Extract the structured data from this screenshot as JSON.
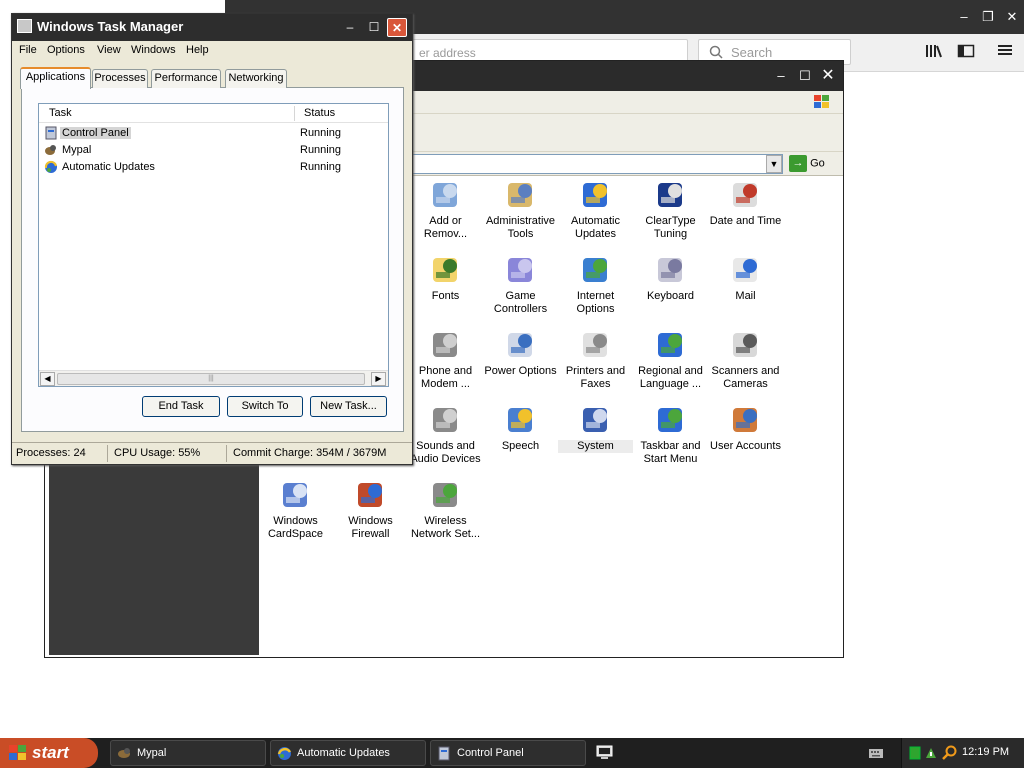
{
  "browser": {
    "url_placeholder": "er address",
    "search_placeholder": "Search",
    "controls": {
      "minimize": "–",
      "restore": "❐",
      "close": "✕"
    },
    "toolbar_icons": [
      "library-icon",
      "sidebar-icon",
      "menu-icon"
    ]
  },
  "control_panel": {
    "go_label": "Go",
    "items": [
      {
        "label": "Add or Remov...",
        "icon": "add-remove-programs-icon"
      },
      {
        "label": "Administrative Tools",
        "icon": "administrative-tools-icon"
      },
      {
        "label": "Automatic Updates",
        "icon": "automatic-updates-icon"
      },
      {
        "label": "ClearType Tuning",
        "icon": "cleartype-icon"
      },
      {
        "label": "Date and Time",
        "icon": "date-time-icon"
      },
      {
        "label": "Fonts",
        "icon": "fonts-icon"
      },
      {
        "label": "Game Controllers",
        "icon": "game-controllers-icon"
      },
      {
        "label": "Internet Options",
        "icon": "internet-options-icon"
      },
      {
        "label": "Keyboard",
        "icon": "keyboard-icon"
      },
      {
        "label": "Mail",
        "icon": "mail-icon"
      },
      {
        "label": "Phone and Modem ...",
        "icon": "phone-modem-icon"
      },
      {
        "label": "Power Options",
        "icon": "power-options-icon"
      },
      {
        "label": "Printers and Faxes",
        "icon": "printers-icon"
      },
      {
        "label": "Regional and Language ...",
        "icon": "regional-icon"
      },
      {
        "label": "Scanners and Cameras",
        "icon": "scanners-icon"
      },
      {
        "label": "Sounds and Audio Devices",
        "icon": "sounds-icon"
      },
      {
        "label": "Speech",
        "icon": "speech-icon"
      },
      {
        "label": "System",
        "icon": "system-icon"
      },
      {
        "label": "Taskbar and Start Menu",
        "icon": "taskbar-icon"
      },
      {
        "label": "User Accounts",
        "icon": "user-accounts-icon"
      },
      {
        "label": "Windows CardSpace",
        "icon": "cardspace-icon"
      },
      {
        "label": "Windows Firewall",
        "icon": "firewall-icon"
      },
      {
        "label": "Wireless Network Set...",
        "icon": "wireless-icon"
      }
    ]
  },
  "task_manager": {
    "title": "Windows Task Manager",
    "menu": [
      "File",
      "Options",
      "View",
      "Windows",
      "Help"
    ],
    "tabs": [
      "Applications",
      "Processes",
      "Performance",
      "Networking"
    ],
    "active_tab": "Applications",
    "columns": {
      "task": "Task",
      "status": "Status"
    },
    "rows": [
      {
        "task": "Control Panel",
        "status": "Running",
        "selected": true
      },
      {
        "task": "Mypal",
        "status": "Running",
        "selected": false
      },
      {
        "task": "Automatic Updates",
        "status": "Running",
        "selected": false
      }
    ],
    "buttons": {
      "end_task": "End Task",
      "switch_to": "Switch To",
      "new_task": "New Task..."
    },
    "status": {
      "processes": "Processes: 24",
      "cpu": "CPU Usage: 55%",
      "commit": "Commit Charge: 354M / 3679M"
    }
  },
  "taskbar": {
    "start_label": "start",
    "buttons": [
      "Mypal",
      "Automatic Updates",
      "Control Panel"
    ],
    "clock": "12:19 PM"
  }
}
